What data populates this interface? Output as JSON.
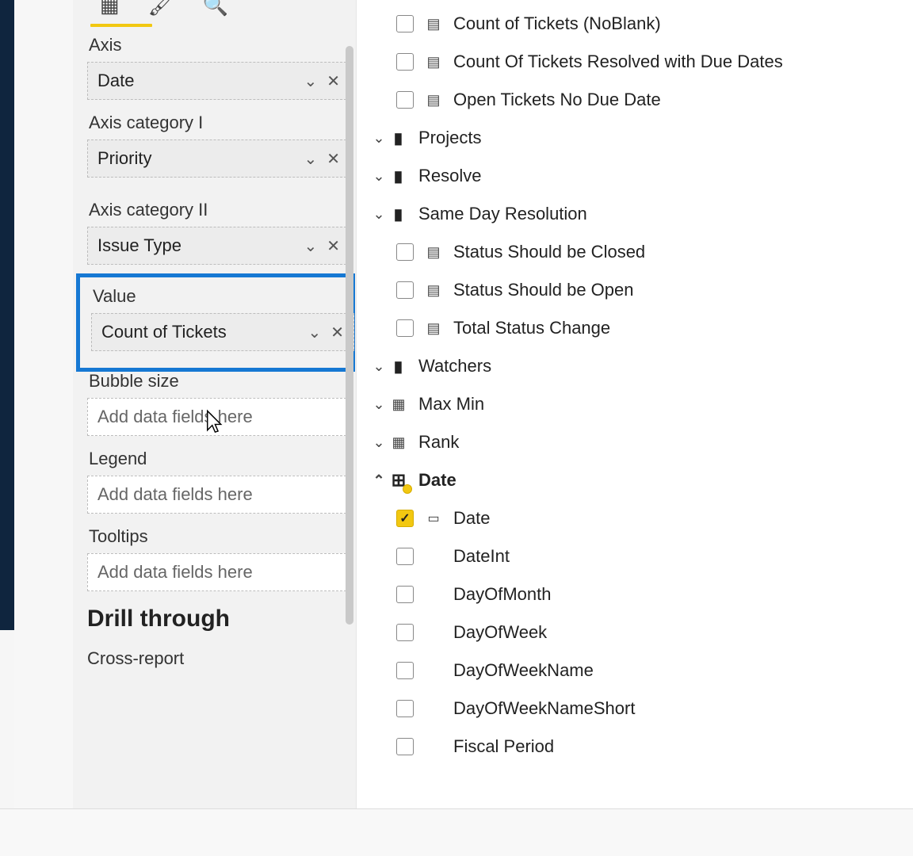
{
  "format": {
    "axis_label": "Axis",
    "axis_value": "Date",
    "axis_cat1_label": "Axis category I",
    "axis_cat1_value": "Priority",
    "axis_cat2_label": "Axis category II",
    "axis_cat2_value": "Issue Type",
    "value_label": "Value",
    "value_value": "Count of Tickets",
    "bubble_label": "Bubble size",
    "bubble_placeholder": "Add data fields here",
    "legend_label": "Legend",
    "legend_placeholder": "Add data fields here",
    "tooltips_label": "Tooltips",
    "tooltips_placeholder": "Add data fields here",
    "drill_heading": "Drill through",
    "cross_report": "Cross-report"
  },
  "fields": {
    "measures_top": [
      "Count of Tickets (NoBlank)",
      "Count Of Tickets Resolved with Due Dates",
      "Open Tickets No Due Date"
    ],
    "folders": {
      "projects": "Projects",
      "resolve": "Resolve",
      "same_day": "Same Day Resolution",
      "watchers": "Watchers"
    },
    "same_day_items": [
      "Status Should be Closed",
      "Status Should be Open",
      "Total Status Change"
    ],
    "extra_meas": {
      "maxmin": "Max Min",
      "rank": "Rank"
    },
    "date_table": "Date",
    "date_cols": [
      {
        "name": "Date",
        "checked": true,
        "icon": true
      },
      {
        "name": "DateInt"
      },
      {
        "name": "DayOfMonth"
      },
      {
        "name": "DayOfWeek"
      },
      {
        "name": "DayOfWeekName"
      },
      {
        "name": "DayOfWeekNameShort"
      },
      {
        "name": "Fiscal Period"
      }
    ]
  }
}
